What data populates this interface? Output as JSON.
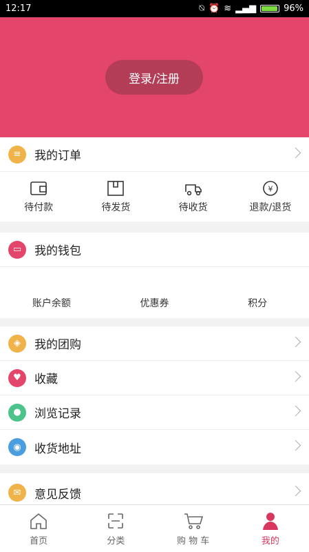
{
  "status": {
    "time": "12:17",
    "battery": "96%",
    "battery_level": 0.96
  },
  "colors": {
    "accent": "#e4456a",
    "active": "#d8385e"
  },
  "hero": {
    "login_label": "登录/注册"
  },
  "orders": {
    "title": "我的订单",
    "items": [
      {
        "label": "待付款",
        "icon": "wallet-icon"
      },
      {
        "label": "待发货",
        "icon": "box-icon"
      },
      {
        "label": "待收货",
        "icon": "truck-icon"
      },
      {
        "label": "退款/退货",
        "icon": "refund-icon"
      }
    ]
  },
  "wallet": {
    "title": "我的钱包",
    "items": [
      {
        "label": "账户余额"
      },
      {
        "label": "优惠券"
      },
      {
        "label": "积分"
      }
    ]
  },
  "menu": {
    "items": [
      {
        "label": "我的团购",
        "icon": "tag-icon",
        "color": "#f0b34a"
      },
      {
        "label": "收藏",
        "icon": "heart-icon",
        "color": "#e4456a"
      },
      {
        "label": "浏览记录",
        "icon": "footprint-icon",
        "color": "#4cc38a"
      },
      {
        "label": "收货地址",
        "icon": "location-icon",
        "color": "#4a9ee0"
      }
    ]
  },
  "feedback": {
    "label": "意见反馈",
    "icon": "mail-icon",
    "color": "#f0b34a"
  },
  "nav": {
    "items": [
      {
        "label": "首页",
        "icon": "home-icon"
      },
      {
        "label": "分类",
        "icon": "category-icon"
      },
      {
        "label": "购 物 车",
        "icon": "cart-icon"
      },
      {
        "label": "我的",
        "icon": "profile-icon"
      }
    ]
  }
}
